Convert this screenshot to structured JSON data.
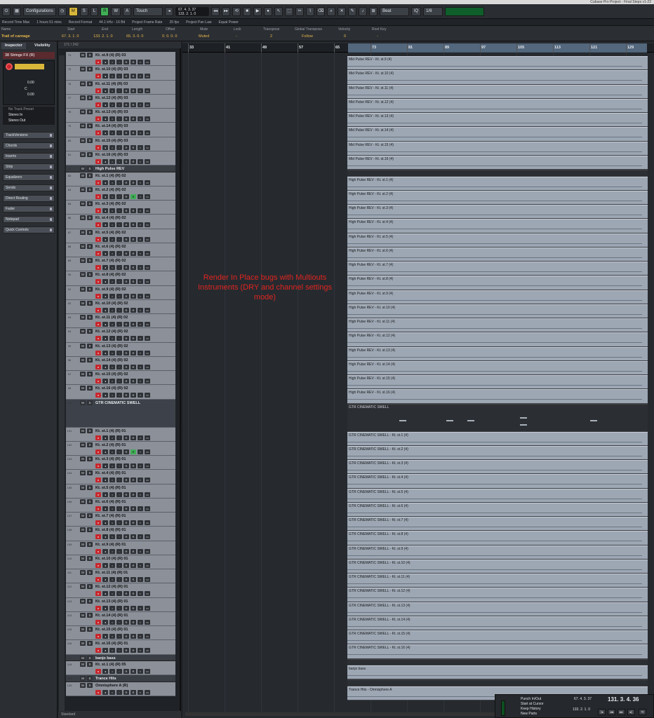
{
  "window": {
    "title": "Cubase Pro Project - Final Steps v1-22"
  },
  "toolbar": {
    "configurations": "Configurations",
    "automation_mode": "Touch",
    "mode_letters": [
      "M",
      "S",
      "L",
      "R",
      "W",
      "A"
    ],
    "pos_primary": "67. 4. 3. 37",
    "pos_secondary": "133. 2. 1. 0",
    "snap_type": "Beat",
    "quantize": "1/8",
    "iq_label": "iQ"
  },
  "statusbar": {
    "items": [
      "Record Time Max",
      "1 hours 51 mins",
      "Record Format",
      "44.1 kHz - 16 Bit",
      "Project Frame Rate",
      "25 fps",
      "Project Pan Law",
      "Equal Power"
    ]
  },
  "infoline": {
    "captions": [
      "Name",
      "Start",
      "End",
      "Length",
      "Offset",
      "Mute",
      "Lock",
      "Transpose",
      "Global Transpose",
      "Velocity",
      "Root Key"
    ],
    "values": [
      "Trail of carnage",
      "67. 3. 1. 0",
      "133. 2. 1. 0",
      "65. 3. 0. 0",
      "0. 0. 0. 0",
      "Muted",
      "-",
      "2",
      "Follow",
      "0",
      "-"
    ]
  },
  "inspector": {
    "tabs": [
      "Inspector",
      "Visibility"
    ],
    "track_name": "Strings FX (R)",
    "track_num": "38",
    "vol_value": "0.00",
    "pan_value": "0.00",
    "pan_center": "C",
    "preset": "No Track Preset",
    "input": "Stereo In",
    "output": "Stereo Out",
    "sections": [
      "TrackVersions",
      "Chords",
      "Inserts",
      "Strip",
      "Equalizers",
      "Sends",
      "Direct Routing",
      "Fader",
      "Notepad",
      "Quick Controls"
    ]
  },
  "trackpanel": {
    "counter": "171 / 242",
    "footer": "Standard"
  },
  "tracks": [
    {
      "num": "74",
      "name": "Kt. st.9 (4) (R) 03",
      "kind": "audio"
    },
    {
      "num": "75",
      "name": "Kt. st.10 (4) (R) 03",
      "kind": "audio"
    },
    {
      "num": "76",
      "name": "Kt. st.11 (4) (R) 03",
      "kind": "audio"
    },
    {
      "num": "77",
      "name": "Kt. st.12 (4) (R) 03",
      "kind": "audio"
    },
    {
      "num": "78",
      "name": "Kt. st.13 (4) (R) 03",
      "kind": "audio"
    },
    {
      "num": "79",
      "name": "Kt. st.14 (4) (R) 03",
      "kind": "audio"
    },
    {
      "num": "80",
      "name": "Kt. st.15 (4) (R) 03",
      "kind": "audio"
    },
    {
      "num": "81",
      "name": "Kt. st.16 (4) (R) 03",
      "kind": "audio"
    },
    {
      "num": "82",
      "name": "High Pulse REV",
      "kind": "folder"
    },
    {
      "num": "83",
      "name": "Kt. st.1 (4) (R) 02",
      "kind": "audio"
    },
    {
      "num": "84",
      "name": "Kt. st.2 (4) (R) 02",
      "kind": "audio",
      "green": true
    },
    {
      "num": "85",
      "name": "Kt. st.3 (4) (R) 02",
      "kind": "audio"
    },
    {
      "num": "86",
      "name": "Kt. st.4 (4) (R) 02",
      "kind": "audio"
    },
    {
      "num": "87",
      "name": "Kt. st.5 (4) (R) 02",
      "kind": "audio"
    },
    {
      "num": "88",
      "name": "Kt. st.6 (4) (R) 02",
      "kind": "audio"
    },
    {
      "num": "89",
      "name": "Kt. st.7 (4) (R) 02",
      "kind": "audio"
    },
    {
      "num": "90",
      "name": "Kt. st.8 (4) (R) 02",
      "kind": "audio"
    },
    {
      "num": "91",
      "name": "Kt. st.9 (4) (R) 02",
      "kind": "audio"
    },
    {
      "num": "92",
      "name": "Kt. st.10 (4) (R) 02",
      "kind": "audio"
    },
    {
      "num": "93",
      "name": "Kt. st.11 (4) (R) 02",
      "kind": "audio"
    },
    {
      "num": "94",
      "name": "Kt. st.12 (4) (R) 02",
      "kind": "audio"
    },
    {
      "num": "95",
      "name": "Kt. st.13 (4) (R) 02",
      "kind": "audio"
    },
    {
      "num": "96",
      "name": "Kt. st.14 (4) (R) 02",
      "kind": "audio"
    },
    {
      "num": "97",
      "name": "Kt. st.15 (4) (R) 02",
      "kind": "audio"
    },
    {
      "num": "98",
      "name": "Kt. st.16 (4) (R) 02",
      "kind": "audio"
    },
    {
      "num": "100",
      "name": "GTR CINEMATIC SWELL",
      "kind": "instrument"
    },
    {
      "num": "101",
      "name": "Kt. st.1 (4) (R) 01",
      "kind": "audio"
    },
    {
      "num": "102",
      "name": "Kt. st.2 (4) (R) 01",
      "kind": "audio",
      "green": true
    },
    {
      "num": "103",
      "name": "Kt. st.3 (4) (R) 01",
      "kind": "audio"
    },
    {
      "num": "104",
      "name": "Kt. st.4 (4) (R) 01",
      "kind": "audio"
    },
    {
      "num": "105",
      "name": "Kt. st.5 (4) (R) 01",
      "kind": "audio"
    },
    {
      "num": "106",
      "name": "Kt. st.6 (4) (R) 01",
      "kind": "audio"
    },
    {
      "num": "107",
      "name": "Kt. st.7 (4) (R) 01",
      "kind": "audio"
    },
    {
      "num": "108",
      "name": "Kt. st.8 (4) (R) 01",
      "kind": "audio"
    },
    {
      "num": "109",
      "name": "Kt. st.9 (4) (R) 01",
      "kind": "audio"
    },
    {
      "num": "110",
      "name": "Kt. st.10 (4) (R) 01",
      "kind": "audio"
    },
    {
      "num": "111",
      "name": "Kt. st.11 (4) (R) 01",
      "kind": "audio"
    },
    {
      "num": "112",
      "name": "Kt. st.12 (4) (R) 01",
      "kind": "audio"
    },
    {
      "num": "113",
      "name": "Kt. st.13 (4) (R) 01",
      "kind": "audio"
    },
    {
      "num": "114",
      "name": "Kt. st.14 (4) (R) 01",
      "kind": "audio"
    },
    {
      "num": "115",
      "name": "Kt. st.15 (4) (R) 01",
      "kind": "audio"
    },
    {
      "num": "116",
      "name": "Kt. st.16 (4) (R) 01",
      "kind": "audio"
    },
    {
      "num": "117",
      "name": "banjo bass",
      "kind": "folder"
    },
    {
      "num": "118",
      "name": "Kt.    st.1 (4) (R) 05",
      "kind": "audio"
    },
    {
      "num": "119",
      "name": "Trance Hits",
      "kind": "folder"
    },
    {
      "num": "120",
      "name": "Omnisphere A (R)",
      "kind": "audio"
    }
  ],
  "events": [
    "Mid Pulse REV - Kt. st.9 (4)",
    "Mid Pulse REV - Kt. st.10 (4)",
    "Mid Pulse REV - Kt. st.11 (4)",
    "Mid Pulse REV - Kt. st.12 (4)",
    "Mid Pulse REV - Kt. st.13 (4)",
    "Mid Pulse REV - Kt. st.14 (4)",
    "Mid Pulse REV - Kt. st.15 (4)",
    "Mid Pulse REV - Kt. st.16 (4)",
    "",
    "High Pulse REV - Kt. st.1 (4)",
    "High Pulse REV - Kt. st.2 (4)",
    "High Pulse REV - Kt. st.3 (4)",
    "High Pulse REV - Kt. st.4 (4)",
    "High Pulse REV - Kt. st.5 (4)",
    "High Pulse REV - Kt. st.6 (4)",
    "High Pulse REV - Kt. st.7 (4)",
    "High Pulse REV - Kt. st.8 (4)",
    "High Pulse REV - Kt. st.9 (4)",
    "High Pulse REV - Kt. st.10 (4)",
    "High Pulse REV - Kt. st.11 (4)",
    "High Pulse REV - Kt. st.12 (4)",
    "High Pulse REV - Kt. st.13 (4)",
    "High Pulse REV - Kt. st.14 (4)",
    "High Pulse REV - Kt. st.15 (4)",
    "High Pulse REV - Kt. st.16 (4)",
    "GTR CINEMATIC SWELL",
    "GTR CINEMATIC SWELL - Kt. st.1 (4)",
    "GTR CINEMATIC SWELL - Kt. st.2 (4)",
    "GTR CINEMATIC SWELL - Kt. st.3 (4)",
    "GTR CINEMATIC SWELL - Kt. st.4 (4)",
    "GTR CINEMATIC SWELL - Kt. st.5 (4)",
    "GTR CINEMATIC SWELL - Kt. st.6 (4)",
    "GTR CINEMATIC SWELL - Kt. st.7 (4)",
    "GTR CINEMATIC SWELL - Kt. st.8 (4)",
    "GTR CINEMATIC SWELL - Kt. st.9 (4)",
    "GTR CINEMATIC SWELL - Kt. st.10 (4)",
    "GTR CINEMATIC SWELL - Kt. st.11 (4)",
    "GTR CINEMATIC SWELL - Kt. st.12 (4)",
    "GTR CINEMATIC SWELL - Kt. st.13 (4)",
    "GTR CINEMATIC SWELL - Kt. st.14 (4)",
    "GTR CINEMATIC SWELL - Kt. st.15 (4)",
    "GTR CINEMATIC SWELL - Kt. st.16 (4)",
    "",
    "banjo bass",
    "",
    "Trance Hits - Omnisphere A"
  ],
  "ruler": {
    "marks": [
      "33",
      "41",
      "49",
      "57",
      "65",
      "73",
      "81",
      "89",
      "97",
      "105",
      "113",
      "121",
      "129"
    ]
  },
  "annotation": {
    "text": "Render In Place bugs with Multiouts Instruments (DRY and channel settings mode)",
    "color": "#e0241f"
  },
  "transport": {
    "punch": "Punch In/Out",
    "start": "Start at Cursor",
    "history": "Keep History",
    "parts": "New Parts",
    "pos_l": "67. 4. 3. 37",
    "pos_r": "133. 2. 1. 0",
    "big": "131. 3. 4. 36"
  },
  "colors": {
    "accent_record": "#c8262c",
    "mute_yellow": "#d8b63a",
    "solo_green": "#3fae55",
    "cycle_blue": "#7fa3c6"
  }
}
